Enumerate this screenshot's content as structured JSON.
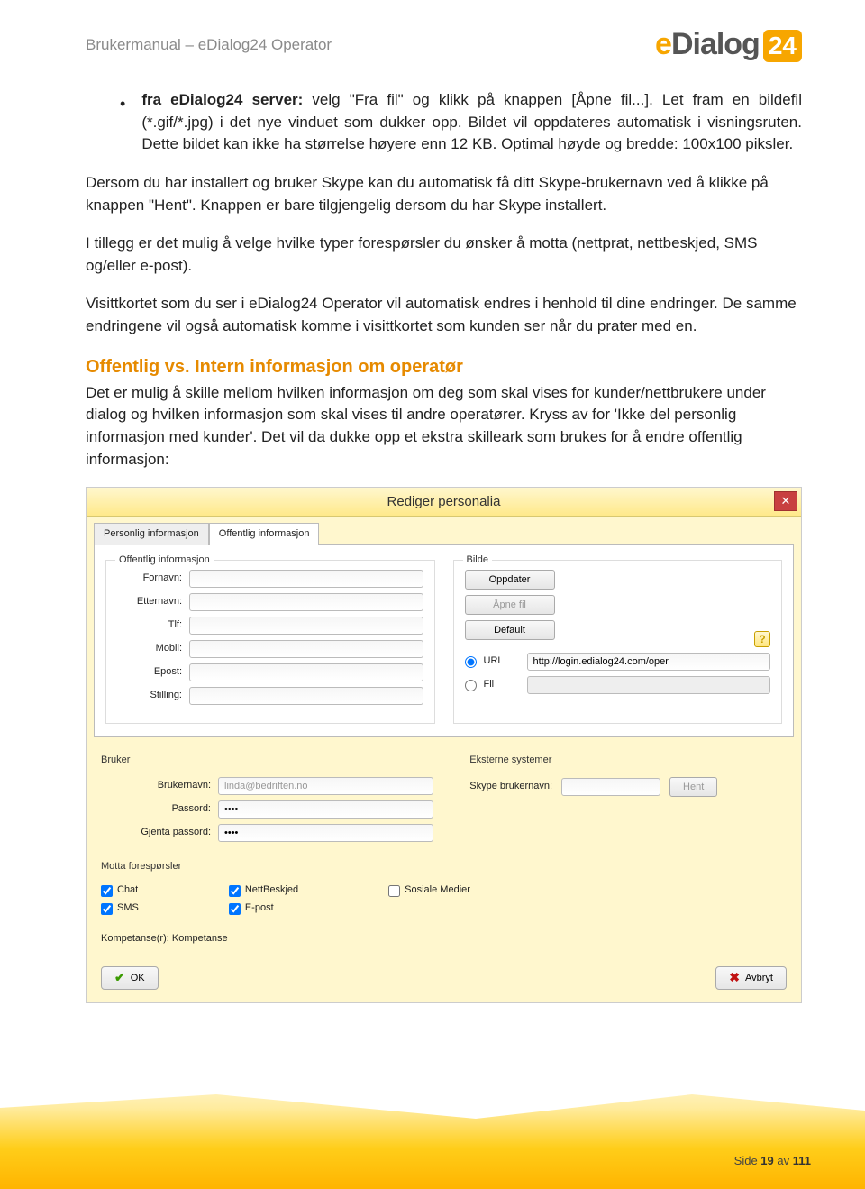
{
  "header": {
    "title": "Brukermanual – eDialog24 Operator",
    "logo_e": "e",
    "logo_dialog": "Dialog",
    "logo_badge": "24"
  },
  "bullet": {
    "lead_bold": "fra eDialog24 server:",
    "text": " velg \"Fra fil\" og klikk på knappen [Åpne fil...]. Let fram en bildefil (*.gif/*.jpg) i det nye vinduet som dukker opp. Bildet vil oppdateres automatisk i visningsruten. Dette bildet kan ikke ha størrelse høyere enn 12 KB. Optimal høyde og bredde: 100x100 piksler."
  },
  "paras": {
    "p1": "Dersom du har installert og bruker Skype kan du automatisk få ditt Skype-brukernavn ved å klikke på knappen \"Hent\". Knappen er bare tilgjengelig dersom du har Skype installert.",
    "p2": "I tillegg er det mulig å velge hvilke typer forespørsler du ønsker å motta (nettprat, nettbeskjed, SMS og/eller e-post).",
    "p3": "Visittkortet som du ser i eDialog24 Operator vil automatisk endres i henhold til dine endringer. De samme endringene vil også automatisk komme i visittkortet som kunden ser når du prater med en."
  },
  "section": {
    "heading": "Offentlig vs. Intern informasjon om operatør",
    "body": "Det er mulig å skille mellom hvilken informasjon om deg som skal vises for kunder/nettbrukere under dialog og hvilken informasjon som skal vises til andre operatører. Kryss av for 'Ikke del personlig informasjon med kunder'. Det vil da dukke opp et ekstra skilleark som brukes for å endre offentlig informasjon:"
  },
  "dialog": {
    "title": "Rediger personalia",
    "close": "✕",
    "tabs": {
      "t1": "Personlig informasjon",
      "t2": "Offentlig informasjon"
    },
    "fieldset1": {
      "legend": "Offentlig informasjon",
      "labels": {
        "fornavn": "Fornavn:",
        "etternavn": "Etternavn:",
        "tlf": "Tlf:",
        "mobil": "Mobil:",
        "epost": "Epost:",
        "stilling": "Stilling:"
      }
    },
    "fieldset2": {
      "legend": "Bilde",
      "btn_oppdater": "Oppdater",
      "btn_apne": "Åpne fil",
      "btn_default": "Default",
      "help": "?",
      "radio_url": "URL",
      "radio_fil": "Fil",
      "url_value": "http://login.edialog24.com/oper"
    },
    "lower": {
      "bruker_title": "Bruker",
      "ekst_title": "Eksterne systemer",
      "brukernavn_label": "Brukernavn:",
      "brukernavn_value": "linda@bedriften.no",
      "passord_label": "Passord:",
      "passord_value": "••••",
      "gjenta_label": "Gjenta passord:",
      "gjenta_value": "••••",
      "skype_label": "Skype brukernavn:",
      "hent_btn": "Hent",
      "motta_title": "Motta forespørsler",
      "chk_chat": "Chat",
      "chk_sms": "SMS",
      "chk_nettbeskjed": "NettBeskjed",
      "chk_epost": "E-post",
      "chk_sosiale": "Sosiale Medier",
      "kompetanse": "Kompetanse(r): Kompetanse",
      "ok": "OK",
      "avbryt": "Avbryt"
    }
  },
  "footer": {
    "side": "Side ",
    "num": "19",
    "av": " av ",
    "total": "111"
  }
}
